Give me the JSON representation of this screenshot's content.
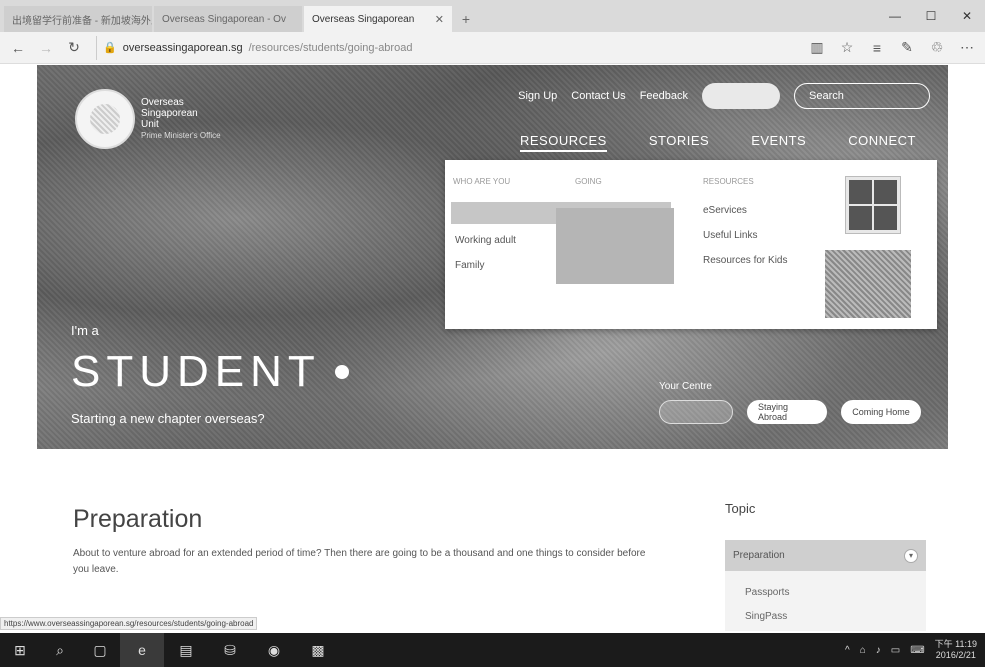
{
  "browser": {
    "tabs": [
      {
        "title": "出境留学行前准备 - 新加坡海外人"
      },
      {
        "title": "Overseas Singaporean - Ov"
      },
      {
        "title": "Overseas Singaporean",
        "active": true
      }
    ],
    "new_tab": "+",
    "win": {
      "minimize": "—",
      "maximize": "☐",
      "close": "✕"
    },
    "nav": {
      "back": "←",
      "forward": "→",
      "refresh": "↻"
    },
    "address": {
      "domain": "overseassingaporean.sg",
      "path": "/resources/students/going-abroad"
    },
    "status_url": "https://www.overseassingaporean.sg/resources/students/going-abroad"
  },
  "site": {
    "logo_lines": [
      "Overseas",
      "Singaporean",
      "Unit"
    ],
    "logo_small": "Prime Minister's Office",
    "toplinks": [
      "Sign Up",
      "Contact Us",
      "Feedback"
    ],
    "search_placeholder": "Search",
    "mainnav": [
      "RESOURCES",
      "STORIES",
      "EVENTS",
      "CONNECT"
    ],
    "hero": {
      "im_a": "I'm a",
      "role": "STUDENT",
      "tagline": "Starting a new chapter overseas?",
      "your_centre": "Your Centre",
      "centre_buttons": [
        "",
        "Staying Abroad",
        "Coming Home"
      ]
    },
    "dropdown": {
      "headers": [
        "WHO ARE YOU",
        "GOING",
        "RESOURCES"
      ],
      "col1": [
        "Working adult",
        "Family"
      ],
      "col3": [
        "eServices",
        "Useful Links",
        "Resources for Kids"
      ]
    }
  },
  "content": {
    "title": "Preparation",
    "text": "About to venture abroad for an extended period of time? Then there are going to be a thousand and one things to consider before you leave.",
    "topic_title": "Topic",
    "topic_selected": "Preparation",
    "topic_items": [
      "Passports",
      "SingPass"
    ]
  },
  "taskbar": {
    "tray_time": "下午 11:19",
    "tray_date": "2016/2/21"
  }
}
